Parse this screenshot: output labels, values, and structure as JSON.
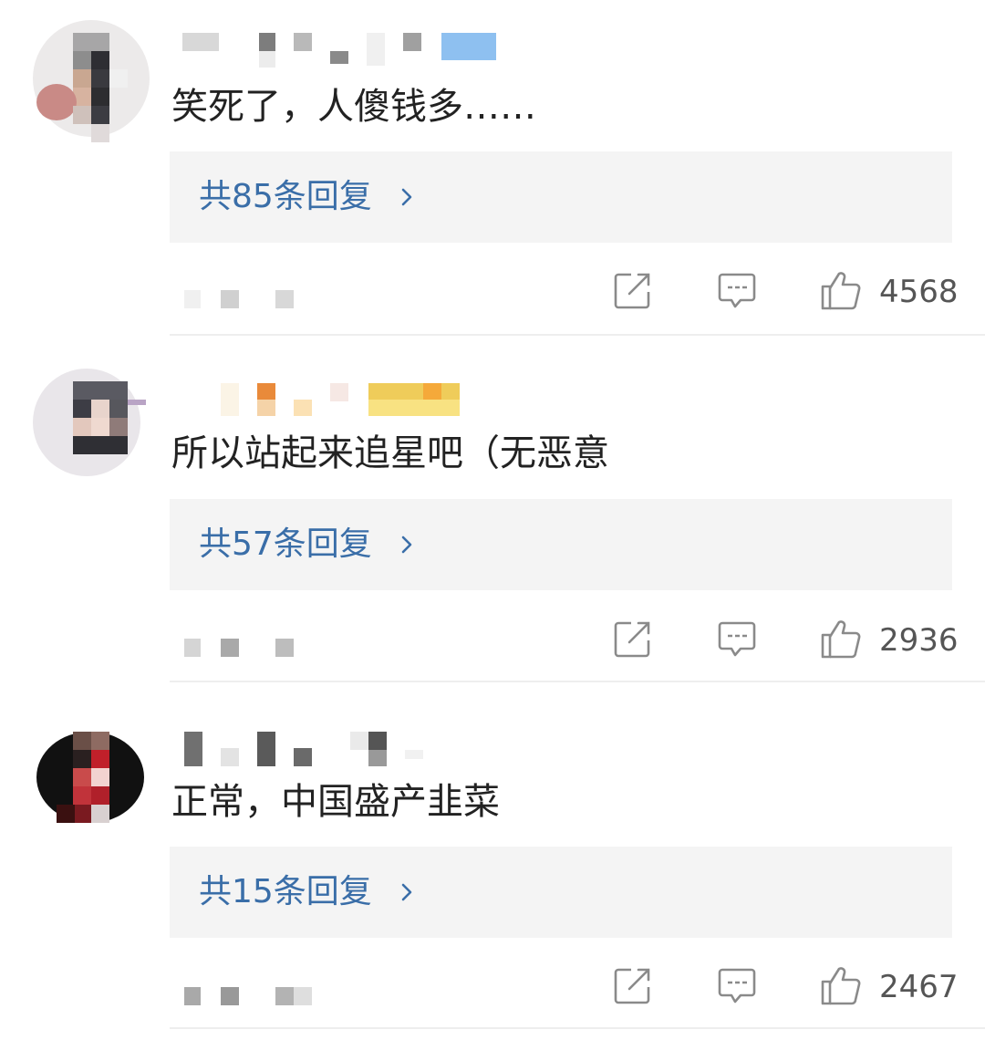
{
  "comments": [
    {
      "text": "笑死了，人傻钱多……",
      "reply_label": "共85条回复",
      "likes": "4568",
      "icons": [
        "share-icon",
        "comment-icon",
        "thumbs-up-icon",
        "chevron-right-icon"
      ],
      "colors": {
        "reply_link": "#3a6ea8",
        "reply_bg": "#f4f4f4"
      }
    },
    {
      "text": "所以站起来追星吧（无恶意",
      "reply_label": "共57条回复",
      "likes": "2936",
      "icons": [
        "share-icon",
        "comment-icon",
        "thumbs-up-icon",
        "chevron-right-icon"
      ],
      "colors": {
        "reply_link": "#3a6ea8",
        "reply_bg": "#f4f4f4"
      }
    },
    {
      "text": "正常，中国盛产韭菜",
      "reply_label": "共15条回复",
      "likes": "2467",
      "icons": [
        "share-icon",
        "comment-icon",
        "thumbs-up-icon",
        "chevron-right-icon"
      ],
      "colors": {
        "reply_link": "#3a6ea8",
        "reply_bg": "#f4f4f4"
      }
    }
  ]
}
